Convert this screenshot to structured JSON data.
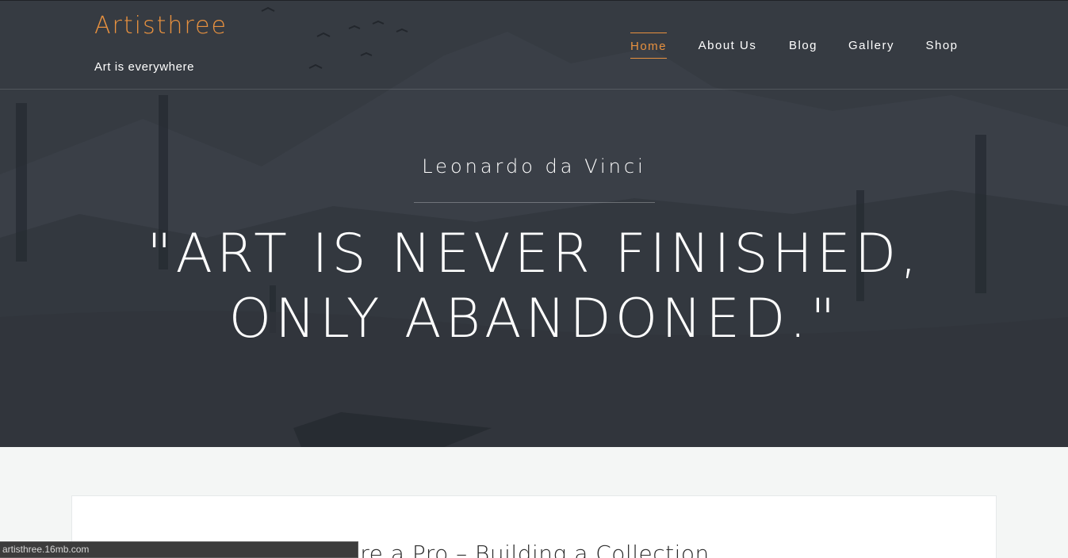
{
  "site": {
    "title": "Artisthree",
    "tagline": "Art is everywhere"
  },
  "nav": {
    "items": [
      {
        "label": "Home",
        "active": true
      },
      {
        "label": "About Us",
        "active": false
      },
      {
        "label": "Blog",
        "active": false
      },
      {
        "label": "Gallery",
        "active": false
      },
      {
        "label": "Shop",
        "active": false
      }
    ]
  },
  "hero": {
    "author": "Leonardo da Vinci",
    "quote": "\"Art is never finished, only abandoned.\""
  },
  "post": {
    "title_visible": "re a Pro – Building a Collection"
  },
  "status_bar": {
    "url": "artisthree.16mb.com"
  },
  "colors": {
    "accent": "#e8913f",
    "hero_overlay": "#363b42",
    "page_bg": "#f4f6f5"
  }
}
